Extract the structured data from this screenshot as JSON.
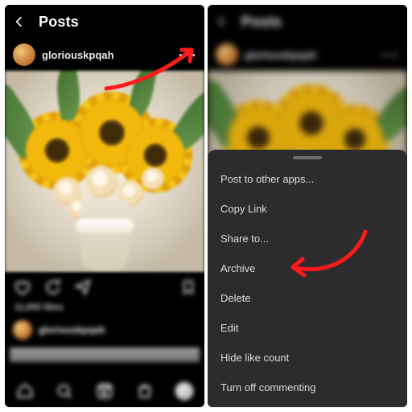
{
  "header": {
    "title": "Posts"
  },
  "user": {
    "name": "gloriouskpqah"
  },
  "actions_row": {
    "likes_line": "11,000 likes"
  },
  "second_user": {
    "name": "gloriouskpqah",
    "caption": "..."
  },
  "menu": {
    "items": [
      "Post to other apps...",
      "Copy Link",
      "Share to...",
      "Archive",
      "Delete",
      "Edit",
      "Hide like count",
      "Turn off commenting"
    ]
  },
  "annotation": {
    "color": "#ff1a1a",
    "target_left": "more-options",
    "target_right": "Archive"
  }
}
